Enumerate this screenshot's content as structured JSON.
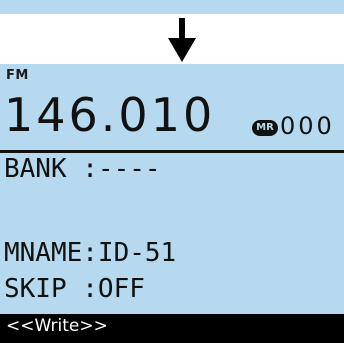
{
  "display": {
    "mode": "FM",
    "frequency": "146.010",
    "memory_badge": "MR",
    "channel": "000"
  },
  "fields": {
    "bank": "BANK :----",
    "mname": "MNAME:ID-51",
    "skip": "SKIP :OFF"
  },
  "action": {
    "write_label": "<<Write>>"
  },
  "colors": {
    "lcd_background": "#b6d9ef",
    "text": "#111111",
    "highlight_bar": "#000000"
  },
  "icons": {
    "arrow": "arrow-down-icon"
  }
}
